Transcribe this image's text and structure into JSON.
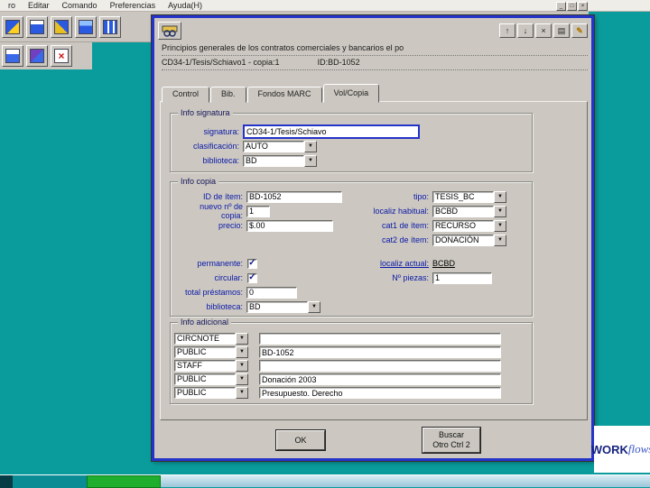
{
  "colors": {
    "desktop": "#0a9c9c",
    "dialog_border": "#2633c8",
    "label": "#0a18a8"
  },
  "icons": {
    "dropdown": "▼",
    "check": "✓",
    "minimize": "_",
    "maximize": "□",
    "close": "×",
    "scroll_up": "↑",
    "scroll_down": "↓",
    "list": "▤",
    "edit": "✎"
  },
  "menu": {
    "items": [
      "ro",
      "Editar",
      "Comando",
      "Preferencias",
      "Ayuda(H)"
    ]
  },
  "dialog": {
    "title_line1": "Principios generales de los contratos comerciales y bancarios el po",
    "title_line2_left": "CD34-1/Tesis/Schiavo1 - copia:1",
    "title_line2_right": "ID:BD-1052",
    "tabs": [
      {
        "label": "Control"
      },
      {
        "label": "Bib."
      },
      {
        "label": "Fondos MARC"
      },
      {
        "label": "Vol/Copia"
      }
    ],
    "info_signatura": {
      "legend": "Info signatura",
      "signatura_label": "signatura:",
      "signatura_value": "CD34-1/Tesis/Schiavo",
      "clasificacion_label": "clasificación:",
      "clasificacion_value": "AUTO",
      "biblioteca_label": "biblioteca:",
      "biblioteca_value": "BD"
    },
    "info_copia": {
      "legend": "Info copia",
      "id_label": "ID de ítem:",
      "id_value": "BD-1052",
      "nuevo_label": "nuevo nº de copia:",
      "nuevo_value": "1",
      "precio_label": "precio:",
      "precio_value": "$.00",
      "tipo_label": "tipo:",
      "tipo_value": "TESIS_BC",
      "localiz_label": "localiz habitual:",
      "localiz_value": "BCBD",
      "cat1_label": "cat1 de ítem:",
      "cat1_value": "RECURSO",
      "cat2_label": "cat2 de ítem:",
      "cat2_value": "DONACIÓN",
      "permanente_label": "permanente:",
      "circular_label": "circular:",
      "total_label": "total préstamos:",
      "total_value": "0",
      "biblioteca_label": "biblioteca:",
      "biblioteca_value": "BD",
      "localiz_actual_label": "localiz actual:",
      "localiz_actual_value": "BCBD",
      "piezas_label": "Nº piezas:",
      "piezas_value": "1"
    },
    "info_adicional": {
      "legend": "Info adicional",
      "rows": [
        {
          "type": "CIRCNOTE",
          "value": ""
        },
        {
          "type": "PUBLIC",
          "value": "BD-1052"
        },
        {
          "type": "STAFF",
          "value": ""
        },
        {
          "type": "PUBLIC",
          "value": "Donación 2003"
        },
        {
          "type": "PUBLIC",
          "value": "Presupuesto. Derecho"
        }
      ]
    },
    "buttons": {
      "ok": "OK",
      "buscar_line1": "Buscar",
      "buscar_line2": "Otro Ctrl 2"
    }
  },
  "logo": {
    "part1": "WORK",
    "part2": "flows"
  }
}
